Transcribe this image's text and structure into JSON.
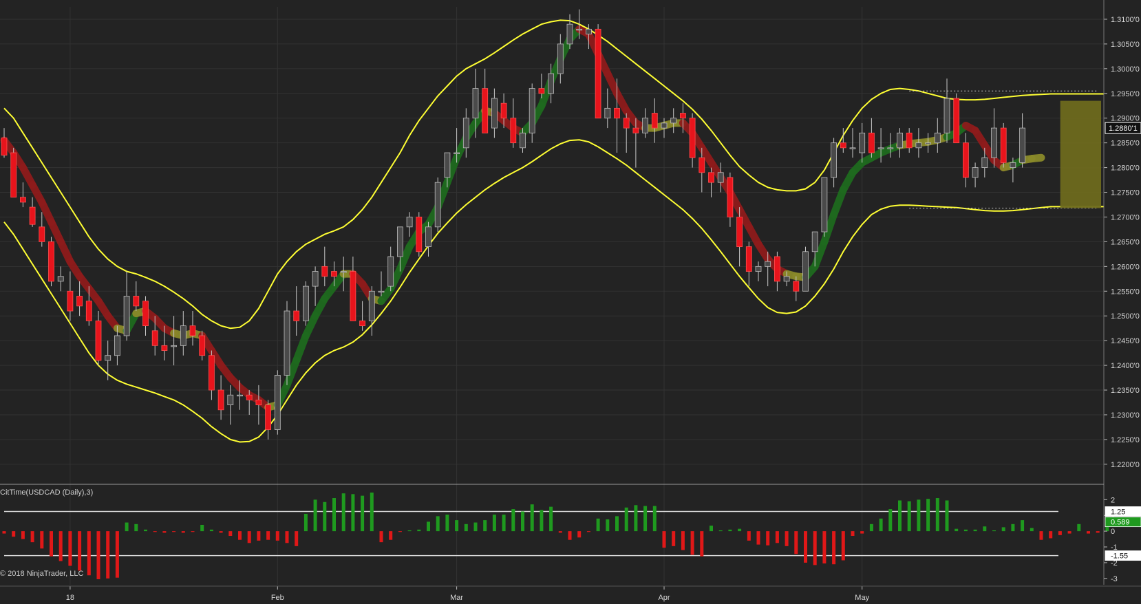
{
  "indicator": {
    "title": "CitTime(USDCAD (Daily),3)"
  },
  "copyright": "© 2018 NinjaTrader, LLC",
  "colors": {
    "background": "#232323",
    "grid": "#333333",
    "axis_text": "#d8d8d8",
    "up_candle": "#4a4a4a",
    "down_candle": "#e8141c",
    "wick": "#c8c8c8",
    "band": "#ffff33",
    "trend_up": "#1e6a1e",
    "trend_down": "#8e1b1b",
    "trend_flat": "#8a8a2a",
    "hist_up": "#1f9a1f",
    "hist_down": "#e01818",
    "projection": "#6e6a1e"
  },
  "chart_data": [
    {
      "type": "candlestick",
      "y_ticks": [
        "1.3100'0",
        "1.3050'0",
        "1.3000'0",
        "1.2950'0",
        "1.2900'0",
        "1.2850'0",
        "1.2800'0",
        "1.2750'0",
        "1.2700'0",
        "1.2650'0",
        "1.2600'0",
        "1.2550'0",
        "1.2500'0",
        "1.2450'0",
        "1.2400'0",
        "1.2350'0",
        "1.2300'0",
        "1.2250'0",
        "1.2200'0"
      ],
      "ylim": [
        1.2165,
        1.3125
      ],
      "x_labels": [
        "18",
        "Feb",
        "Mar",
        "Apr",
        "May"
      ],
      "last_price_label": "1.2880'1",
      "last_price": 1.288,
      "ohlc": [
        [
          1.286,
          1.288,
          1.282,
          1.2825
        ],
        [
          1.283,
          1.284,
          1.274,
          1.274
        ],
        [
          1.274,
          1.277,
          1.272,
          1.273
        ],
        [
          1.272,
          1.274,
          1.268,
          1.2685
        ],
        [
          1.268,
          1.271,
          1.264,
          1.265
        ],
        [
          1.265,
          1.266,
          1.256,
          1.257
        ],
        [
          1.257,
          1.26,
          1.255,
          1.258
        ],
        [
          1.255,
          1.259,
          1.249,
          1.251
        ],
        [
          1.254,
          1.257,
          1.25,
          1.252
        ],
        [
          1.253,
          1.256,
          1.248,
          1.249
        ],
        [
          1.249,
          1.251,
          1.24,
          1.241
        ],
        [
          1.241,
          1.245,
          1.237,
          1.242
        ],
        [
          1.242,
          1.248,
          1.24,
          1.246
        ],
        [
          1.246,
          1.259,
          1.245,
          1.254
        ],
        [
          1.254,
          1.257,
          1.251,
          1.252
        ],
        [
          1.253,
          1.254,
          1.246,
          1.248
        ],
        [
          1.247,
          1.25,
          1.242,
          1.244
        ],
        [
          1.244,
          1.248,
          1.241,
          1.243
        ],
        [
          1.244,
          1.25,
          1.24,
          1.244
        ],
        [
          1.244,
          1.251,
          1.242,
          1.248
        ],
        [
          1.248,
          1.251,
          1.244,
          1.246
        ],
        [
          1.246,
          1.247,
          1.241,
          1.242
        ],
        [
          1.242,
          1.243,
          1.233,
          1.235
        ],
        [
          1.235,
          1.238,
          1.229,
          1.231
        ],
        [
          1.232,
          1.236,
          1.228,
          1.234
        ],
        [
          1.234,
          1.237,
          1.231,
          1.234
        ],
        [
          1.234,
          1.235,
          1.23,
          1.233
        ],
        [
          1.233,
          1.236,
          1.228,
          1.232
        ],
        [
          1.232,
          1.233,
          1.225,
          1.227
        ],
        [
          1.227,
          1.239,
          1.226,
          1.238
        ],
        [
          1.238,
          1.253,
          1.236,
          1.251
        ],
        [
          1.251,
          1.256,
          1.246,
          1.249
        ],
        [
          1.249,
          1.257,
          1.248,
          1.256
        ],
        [
          1.256,
          1.26,
          1.252,
          1.259
        ],
        [
          1.26,
          1.264,
          1.256,
          1.258
        ],
        [
          1.259,
          1.261,
          1.256,
          1.258
        ],
        [
          1.259,
          1.262,
          1.255,
          1.259
        ],
        [
          1.259,
          1.262,
          1.249,
          1.249
        ],
        [
          1.249,
          1.253,
          1.247,
          1.248
        ],
        [
          1.249,
          1.256,
          1.246,
          1.255
        ],
        [
          1.255,
          1.259,
          1.254,
          1.255
        ],
        [
          1.256,
          1.264,
          1.255,
          1.262
        ],
        [
          1.262,
          1.268,
          1.259,
          1.268
        ],
        [
          1.268,
          1.271,
          1.266,
          1.27
        ],
        [
          1.27,
          1.271,
          1.262,
          1.263
        ],
        [
          1.264,
          1.269,
          1.262,
          1.268
        ],
        [
          1.268,
          1.278,
          1.267,
          1.277
        ],
        [
          1.278,
          1.283,
          1.276,
          1.283
        ],
        [
          1.283,
          1.288,
          1.281,
          1.283
        ],
        [
          1.284,
          1.292,
          1.282,
          1.29
        ],
        [
          1.29,
          1.3,
          1.286,
          1.296
        ],
        [
          1.296,
          1.3,
          1.288,
          1.287
        ],
        [
          1.288,
          1.296,
          1.286,
          1.294
        ],
        [
          1.293,
          1.295,
          1.288,
          1.29
        ],
        [
          1.29,
          1.294,
          1.284,
          1.285
        ],
        [
          1.284,
          1.288,
          1.283,
          1.287
        ],
        [
          1.287,
          1.297,
          1.285,
          1.296
        ],
        [
          1.296,
          1.299,
          1.294,
          1.295
        ],
        [
          1.295,
          1.301,
          1.293,
          1.299
        ],
        [
          1.299,
          1.307,
          1.297,
          1.305
        ],
        [
          1.305,
          1.311,
          1.304,
          1.309
        ],
        [
          1.308,
          1.312,
          1.306,
          1.308
        ],
        [
          1.307,
          1.309,
          1.304,
          1.308
        ],
        [
          1.308,
          1.309,
          1.29,
          1.29
        ],
        [
          1.29,
          1.296,
          1.288,
          1.292
        ],
        [
          1.292,
          1.298,
          1.283,
          1.29
        ],
        [
          1.29,
          1.291,
          1.283,
          1.288
        ],
        [
          1.288,
          1.29,
          1.28,
          1.287
        ],
        [
          1.287,
          1.292,
          1.286,
          1.29
        ],
        [
          1.291,
          1.294,
          1.285,
          1.288
        ],
        [
          1.288,
          1.29,
          1.286,
          1.289
        ],
        [
          1.289,
          1.292,
          1.287,
          1.29
        ],
        [
          1.291,
          1.293,
          1.287,
          1.29
        ],
        [
          1.29,
          1.291,
          1.28,
          1.282
        ],
        [
          1.282,
          1.284,
          1.275,
          1.279
        ],
        [
          1.279,
          1.28,
          1.274,
          1.277
        ],
        [
          1.277,
          1.281,
          1.275,
          1.279
        ],
        [
          1.278,
          1.279,
          1.268,
          1.27
        ],
        [
          1.27,
          1.272,
          1.26,
          1.264
        ],
        [
          1.264,
          1.265,
          1.256,
          1.259
        ],
        [
          1.259,
          1.261,
          1.257,
          1.26
        ],
        [
          1.26,
          1.263,
          1.256,
          1.261
        ],
        [
          1.262,
          1.263,
          1.255,
          1.257
        ],
        [
          1.257,
          1.259,
          1.256,
          1.258
        ],
        [
          1.257,
          1.258,
          1.253,
          1.255
        ],
        [
          1.255,
          1.264,
          1.255,
          1.263
        ],
        [
          1.263,
          1.267,
          1.26,
          1.267
        ],
        [
          1.267,
          1.278,
          1.266,
          1.278
        ],
        [
          1.278,
          1.286,
          1.276,
          1.285
        ],
        [
          1.285,
          1.288,
          1.283,
          1.284
        ],
        [
          1.284,
          1.288,
          1.282,
          1.284
        ],
        [
          1.283,
          1.289,
          1.281,
          1.287
        ],
        [
          1.287,
          1.29,
          1.282,
          1.283
        ],
        [
          1.284,
          1.288,
          1.281,
          1.284
        ],
        [
          1.284,
          1.287,
          1.282,
          1.284
        ],
        [
          1.284,
          1.288,
          1.282,
          1.287
        ],
        [
          1.287,
          1.288,
          1.283,
          1.284
        ],
        [
          1.284,
          1.288,
          1.282,
          1.285
        ],
        [
          1.285,
          1.287,
          1.283,
          1.285
        ],
        [
          1.285,
          1.29,
          1.283,
          1.287
        ],
        [
          1.287,
          1.298,
          1.285,
          1.294
        ],
        [
          1.294,
          1.295,
          1.285,
          1.285
        ],
        [
          1.285,
          1.287,
          1.276,
          1.278
        ],
        [
          1.278,
          1.281,
          1.276,
          1.28
        ],
        [
          1.28,
          1.284,
          1.278,
          1.282
        ],
        [
          1.282,
          1.292,
          1.28,
          1.288
        ],
        [
          1.288,
          1.289,
          1.28,
          1.281
        ],
        [
          1.28,
          1.282,
          1.277,
          1.281
        ],
        [
          1.281,
          1.291,
          1.28,
          1.288
        ]
      ],
      "upper_band": [
        1.292,
        1.29,
        1.287,
        1.284,
        1.281,
        1.278,
        1.275,
        1.272,
        1.269,
        1.266,
        1.2635,
        1.2615,
        1.26,
        1.259,
        1.2585,
        1.2578,
        1.257,
        1.256,
        1.2548,
        1.2535,
        1.252,
        1.2503,
        1.249,
        1.248,
        1.2475,
        1.2477,
        1.249,
        1.2515,
        1.255,
        1.2585,
        1.261,
        1.263,
        1.2645,
        1.2655,
        1.2665,
        1.2672,
        1.268,
        1.2695,
        1.2715,
        1.274,
        1.277,
        1.28,
        1.283,
        1.2865,
        1.2895,
        1.292,
        1.2945,
        1.2965,
        1.2985,
        1.3,
        1.301,
        1.302,
        1.3032,
        1.3045,
        1.3058,
        1.307,
        1.308,
        1.309,
        1.3095,
        1.3098,
        1.3097,
        1.309,
        1.308,
        1.3068,
        1.3055,
        1.304,
        1.3025,
        1.301,
        1.2995,
        1.298,
        1.2965,
        1.295,
        1.2935,
        1.2918,
        1.2898,
        1.2875,
        1.285,
        1.2825,
        1.2802,
        1.2785,
        1.277,
        1.276,
        1.2755,
        1.2753,
        1.2753,
        1.2757,
        1.277,
        1.2795,
        1.283,
        1.2865,
        1.2895,
        1.292,
        1.2938,
        1.295,
        1.2958,
        1.296,
        1.2958,
        1.2955,
        1.295,
        1.2945,
        1.294,
        1.2938,
        1.2937,
        1.2937,
        1.2938,
        1.294,
        1.2942,
        1.2944,
        1.2946,
        1.2947,
        1.2948,
        1.2949
      ],
      "lower_band": [
        1.269,
        1.2665,
        1.2635,
        1.2605,
        1.2575,
        1.2545,
        1.2515,
        1.2485,
        1.2455,
        1.2425,
        1.24,
        1.2382,
        1.237,
        1.2362,
        1.2356,
        1.235,
        1.2344,
        1.2337,
        1.233,
        1.232,
        1.2307,
        1.2293,
        1.2276,
        1.2262,
        1.225,
        1.2245,
        1.2246,
        1.2255,
        1.2275,
        1.23,
        1.233,
        1.236,
        1.2385,
        1.2405,
        1.242,
        1.243,
        1.2437,
        1.2447,
        1.2462,
        1.2482,
        1.2505,
        1.253,
        1.2558,
        1.2588,
        1.2615,
        1.2642,
        1.2667,
        1.2688,
        1.2708,
        1.2725,
        1.274,
        1.2755,
        1.2768,
        1.278,
        1.279,
        1.28,
        1.2812,
        1.2825,
        1.2838,
        1.2848,
        1.2855,
        1.2856,
        1.2852,
        1.2842,
        1.283,
        1.2818,
        1.2805,
        1.279,
        1.2775,
        1.276,
        1.2745,
        1.273,
        1.2715,
        1.2697,
        1.2677,
        1.2654,
        1.263,
        1.2605,
        1.258,
        1.2557,
        1.2535,
        1.2517,
        1.2507,
        1.2505,
        1.2508,
        1.252,
        1.254,
        1.2565,
        1.2595,
        1.263,
        1.266,
        1.2685,
        1.2705,
        1.2716,
        1.2722,
        1.2724,
        1.2724,
        1.2723,
        1.2722,
        1.2721,
        1.272,
        1.2719,
        1.2717,
        1.2715,
        1.2713,
        1.2712,
        1.2712,
        1.2713,
        1.2715,
        1.2717,
        1.2719,
        1.2721
      ],
      "trend": [
        1.2855,
        1.283,
        1.28,
        1.2765,
        1.273,
        1.269,
        1.265,
        1.261,
        1.258,
        1.2555,
        1.253,
        1.25,
        1.2475,
        1.247,
        1.2505,
        1.251,
        1.2495,
        1.2475,
        1.2465,
        1.246,
        1.2465,
        1.246,
        1.243,
        1.24,
        1.2375,
        1.2355,
        1.234,
        1.233,
        1.2315,
        1.232,
        1.236,
        1.241,
        1.246,
        1.25,
        1.2535,
        1.256,
        1.2585,
        1.2585,
        1.2565,
        1.2535,
        1.253,
        1.2555,
        1.2595,
        1.264,
        1.267,
        1.2685,
        1.272,
        1.277,
        1.282,
        1.286,
        1.289,
        1.2915,
        1.291,
        1.2895,
        1.288,
        1.287,
        1.289,
        1.2925,
        1.2975,
        1.302,
        1.306,
        1.308,
        1.307,
        1.303,
        1.299,
        1.295,
        1.2915,
        1.289,
        1.288,
        1.288,
        1.2885,
        1.289,
        1.289,
        1.287,
        1.284,
        1.281,
        1.278,
        1.275,
        1.2715,
        1.268,
        1.2645,
        1.2615,
        1.2595,
        1.2585,
        1.258,
        1.2578,
        1.26,
        1.265,
        1.2705,
        1.2755,
        1.279,
        1.281,
        1.282,
        1.283,
        1.2838,
        1.2845,
        1.2848,
        1.285,
        1.2852,
        1.2856,
        1.2862,
        1.287,
        1.2885,
        1.2875,
        1.2845,
        1.2815,
        1.28,
        1.2805,
        1.2815,
        1.2818,
        1.282
      ],
      "resistance_level": 1.2955,
      "support_level": 1.2718,
      "projection_box": [
        1.2718,
        1.2935
      ]
    },
    {
      "type": "bar",
      "y_ticks": [
        "2",
        "1",
        "0",
        "-1",
        "-2",
        "-3"
      ],
      "ylim": [
        -3.4,
        2.8
      ],
      "upper_level": 1.25,
      "lower_level": -1.55,
      "upper_level_label": "1.25",
      "lower_level_label": "-1.55",
      "last_value": 0.589,
      "last_value_label": "0.589",
      "values": [
        -0.15,
        -0.35,
        -0.5,
        -0.7,
        -1.1,
        -1.6,
        -1.9,
        -2.2,
        -2.5,
        -2.8,
        -3.05,
        -3.0,
        -2.95,
        0.55,
        0.45,
        0.1,
        -0.05,
        -0.1,
        -0.05,
        -0.1,
        -0.05,
        0.4,
        0.1,
        -0.1,
        -0.3,
        -0.55,
        -0.75,
        -0.6,
        -0.55,
        -0.6,
        -0.75,
        -0.95,
        1.1,
        2.0,
        1.85,
        2.1,
        2.4,
        2.35,
        2.25,
        2.45,
        -0.7,
        -0.55,
        -0.05,
        0.05,
        0.1,
        0.6,
        0.95,
        1.05,
        0.7,
        0.45,
        0.55,
        0.7,
        1.05,
        1.05,
        1.4,
        1.25,
        1.7,
        1.35,
        1.55,
        -0.1,
        -0.55,
        -0.4,
        -0.05,
        0.8,
        0.75,
        0.95,
        1.5,
        1.65,
        1.6,
        1.6,
        -1.05,
        -0.95,
        -1.2,
        -1.5,
        -1.6,
        0.35,
        0.05,
        0.1,
        0.15,
        -0.6,
        -0.85,
        -0.9,
        -0.75,
        -0.95,
        -1.45,
        -2.0,
        -2.15,
        -2.05,
        -2.1,
        -1.85,
        -0.3,
        -0.15,
        0.45,
        0.8,
        1.4,
        1.95,
        1.9,
        2.0,
        2.05,
        2.1,
        1.95,
        0.15,
        0.1,
        0.1,
        0.3,
        0.05,
        0.25,
        0.45,
        0.7,
        0.2,
        -0.55,
        -0.45,
        -0.25,
        -0.15,
        0.45,
        -0.15,
        -0.1,
        0.589
      ]
    }
  ]
}
